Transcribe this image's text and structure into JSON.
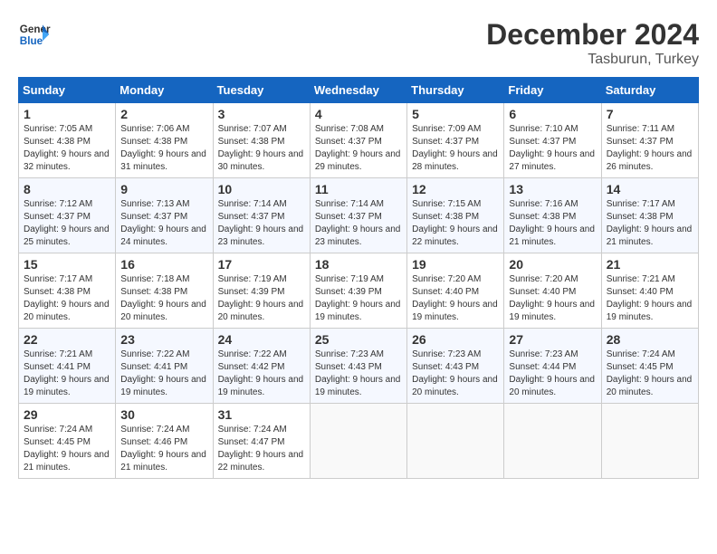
{
  "logo": {
    "line1": "General",
    "line2": "Blue"
  },
  "title": "December 2024",
  "location": "Tasburun, Turkey",
  "days_of_week": [
    "Sunday",
    "Monday",
    "Tuesday",
    "Wednesday",
    "Thursday",
    "Friday",
    "Saturday"
  ],
  "weeks": [
    [
      {
        "day": "1",
        "sunrise": "7:05 AM",
        "sunset": "4:38 PM",
        "daylight": "9 hours and 32 minutes."
      },
      {
        "day": "2",
        "sunrise": "7:06 AM",
        "sunset": "4:38 PM",
        "daylight": "9 hours and 31 minutes."
      },
      {
        "day": "3",
        "sunrise": "7:07 AM",
        "sunset": "4:38 PM",
        "daylight": "9 hours and 30 minutes."
      },
      {
        "day": "4",
        "sunrise": "7:08 AM",
        "sunset": "4:37 PM",
        "daylight": "9 hours and 29 minutes."
      },
      {
        "day": "5",
        "sunrise": "7:09 AM",
        "sunset": "4:37 PM",
        "daylight": "9 hours and 28 minutes."
      },
      {
        "day": "6",
        "sunrise": "7:10 AM",
        "sunset": "4:37 PM",
        "daylight": "9 hours and 27 minutes."
      },
      {
        "day": "7",
        "sunrise": "7:11 AM",
        "sunset": "4:37 PM",
        "daylight": "9 hours and 26 minutes."
      }
    ],
    [
      {
        "day": "8",
        "sunrise": "7:12 AM",
        "sunset": "4:37 PM",
        "daylight": "9 hours and 25 minutes."
      },
      {
        "day": "9",
        "sunrise": "7:13 AM",
        "sunset": "4:37 PM",
        "daylight": "9 hours and 24 minutes."
      },
      {
        "day": "10",
        "sunrise": "7:14 AM",
        "sunset": "4:37 PM",
        "daylight": "9 hours and 23 minutes."
      },
      {
        "day": "11",
        "sunrise": "7:14 AM",
        "sunset": "4:37 PM",
        "daylight": "9 hours and 23 minutes."
      },
      {
        "day": "12",
        "sunrise": "7:15 AM",
        "sunset": "4:38 PM",
        "daylight": "9 hours and 22 minutes."
      },
      {
        "day": "13",
        "sunrise": "7:16 AM",
        "sunset": "4:38 PM",
        "daylight": "9 hours and 21 minutes."
      },
      {
        "day": "14",
        "sunrise": "7:17 AM",
        "sunset": "4:38 PM",
        "daylight": "9 hours and 21 minutes."
      }
    ],
    [
      {
        "day": "15",
        "sunrise": "7:17 AM",
        "sunset": "4:38 PM",
        "daylight": "9 hours and 20 minutes."
      },
      {
        "day": "16",
        "sunrise": "7:18 AM",
        "sunset": "4:38 PM",
        "daylight": "9 hours and 20 minutes."
      },
      {
        "day": "17",
        "sunrise": "7:19 AM",
        "sunset": "4:39 PM",
        "daylight": "9 hours and 20 minutes."
      },
      {
        "day": "18",
        "sunrise": "7:19 AM",
        "sunset": "4:39 PM",
        "daylight": "9 hours and 19 minutes."
      },
      {
        "day": "19",
        "sunrise": "7:20 AM",
        "sunset": "4:40 PM",
        "daylight": "9 hours and 19 minutes."
      },
      {
        "day": "20",
        "sunrise": "7:20 AM",
        "sunset": "4:40 PM",
        "daylight": "9 hours and 19 minutes."
      },
      {
        "day": "21",
        "sunrise": "7:21 AM",
        "sunset": "4:40 PM",
        "daylight": "9 hours and 19 minutes."
      }
    ],
    [
      {
        "day": "22",
        "sunrise": "7:21 AM",
        "sunset": "4:41 PM",
        "daylight": "9 hours and 19 minutes."
      },
      {
        "day": "23",
        "sunrise": "7:22 AM",
        "sunset": "4:41 PM",
        "daylight": "9 hours and 19 minutes."
      },
      {
        "day": "24",
        "sunrise": "7:22 AM",
        "sunset": "4:42 PM",
        "daylight": "9 hours and 19 minutes."
      },
      {
        "day": "25",
        "sunrise": "7:23 AM",
        "sunset": "4:43 PM",
        "daylight": "9 hours and 19 minutes."
      },
      {
        "day": "26",
        "sunrise": "7:23 AM",
        "sunset": "4:43 PM",
        "daylight": "9 hours and 20 minutes."
      },
      {
        "day": "27",
        "sunrise": "7:23 AM",
        "sunset": "4:44 PM",
        "daylight": "9 hours and 20 minutes."
      },
      {
        "day": "28",
        "sunrise": "7:24 AM",
        "sunset": "4:45 PM",
        "daylight": "9 hours and 20 minutes."
      }
    ],
    [
      {
        "day": "29",
        "sunrise": "7:24 AM",
        "sunset": "4:45 PM",
        "daylight": "9 hours and 21 minutes."
      },
      {
        "day": "30",
        "sunrise": "7:24 AM",
        "sunset": "4:46 PM",
        "daylight": "9 hours and 21 minutes."
      },
      {
        "day": "31",
        "sunrise": "7:24 AM",
        "sunset": "4:47 PM",
        "daylight": "9 hours and 22 minutes."
      },
      null,
      null,
      null,
      null
    ]
  ]
}
